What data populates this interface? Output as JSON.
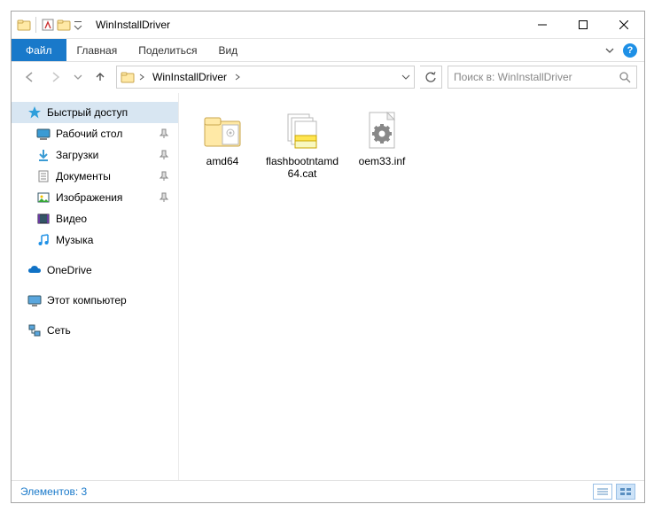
{
  "titlebar": {
    "title": "WinInstallDriver"
  },
  "ribbon": {
    "file": "Файл",
    "tabs": [
      "Главная",
      "Поделиться",
      "Вид"
    ]
  },
  "address": {
    "crumbs": [
      "WinInstallDriver"
    ],
    "search_placeholder": "Поиск в: WinInstallDriver"
  },
  "nav": {
    "quick_access": "Быстрый доступ",
    "items": [
      {
        "label": "Рабочий стол",
        "icon": "desktop",
        "pinned": true
      },
      {
        "label": "Загрузки",
        "icon": "downloads",
        "pinned": true
      },
      {
        "label": "Документы",
        "icon": "documents",
        "pinned": true
      },
      {
        "label": "Изображения",
        "icon": "pictures",
        "pinned": true
      },
      {
        "label": "Видео",
        "icon": "videos",
        "pinned": false
      },
      {
        "label": "Музыка",
        "icon": "music",
        "pinned": false
      }
    ],
    "onedrive": "OneDrive",
    "this_pc": "Этот компьютер",
    "network": "Сеть"
  },
  "files": [
    {
      "name": "amd64",
      "type": "folder"
    },
    {
      "name": "flashbootntamd64.cat",
      "type": "cat"
    },
    {
      "name": "oem33.inf",
      "type": "inf"
    }
  ],
  "status": {
    "count_label": "Элементов: 3"
  }
}
